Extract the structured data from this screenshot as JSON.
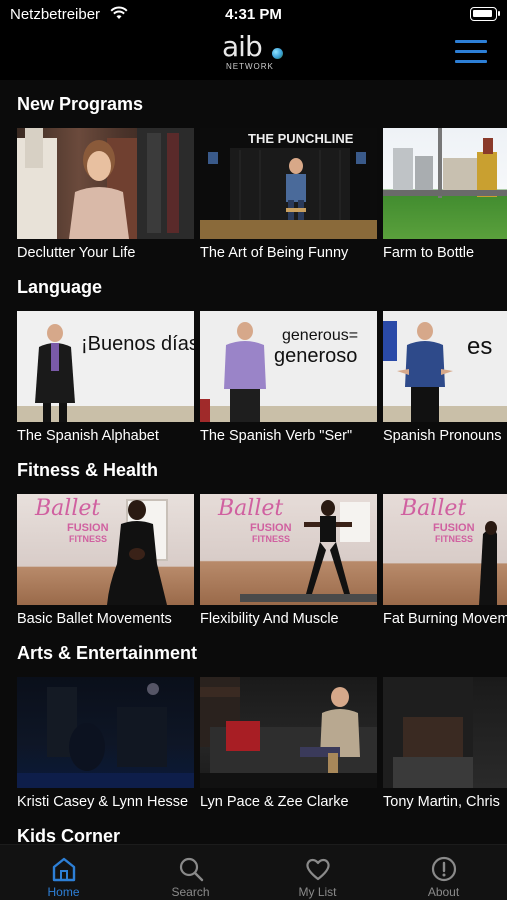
{
  "status_bar": {
    "carrier": "Netzbetreiber",
    "time": "4:31 PM"
  },
  "header": {
    "logo_text": "aib",
    "logo_subtext": "NETWORK"
  },
  "sections": [
    {
      "title": "New Programs",
      "items": [
        {
          "title": "Declutter Your Life"
        },
        {
          "title": "The Art of Being Funny",
          "thumb_text": "THE PUNCHLINE"
        },
        {
          "title": "Farm to Bottle"
        }
      ]
    },
    {
      "title": "Language",
      "items": [
        {
          "title": "The Spanish Alphabet",
          "thumb_text": "¡Buenos días"
        },
        {
          "title": "The Spanish Verb \"Ser\"",
          "thumb_text": "generous=",
          "thumb_text2": "generoso"
        },
        {
          "title": "Spanish Pronouns",
          "thumb_text": "es"
        }
      ]
    },
    {
      "title": "Fitness & Health",
      "items": [
        {
          "title": "Basic Ballet Movements",
          "thumb_text": "Ballet",
          "thumb_text2": "FUSION",
          "thumb_text3": "FITNESS"
        },
        {
          "title": "Flexibility And Muscle",
          "thumb_text": "Ballet",
          "thumb_text2": "FUSION",
          "thumb_text3": "FITNESS"
        },
        {
          "title": "Fat Burning Movements",
          "thumb_text": "Ballet",
          "thumb_text2": "FUSION",
          "thumb_text3": "FITNESS"
        }
      ]
    },
    {
      "title": "Arts & Entertainment",
      "items": [
        {
          "title": "Kristi Casey & Lynn Hesse"
        },
        {
          "title": "Lyn Pace & Zee Clarke"
        },
        {
          "title": "Tony Martin, Chris"
        }
      ]
    },
    {
      "title": "Kids Corner",
      "items": []
    }
  ],
  "tabs": [
    {
      "label": "Home",
      "icon": "home-icon",
      "active": true
    },
    {
      "label": "Search",
      "icon": "search-icon",
      "active": false
    },
    {
      "label": "My List",
      "icon": "heart-icon",
      "active": false
    },
    {
      "label": "About",
      "icon": "info-icon",
      "active": false
    }
  ],
  "colors": {
    "accent": "#2d7fd6",
    "background": "#0b0b0b",
    "tab_inactive": "#8a8a8a"
  }
}
